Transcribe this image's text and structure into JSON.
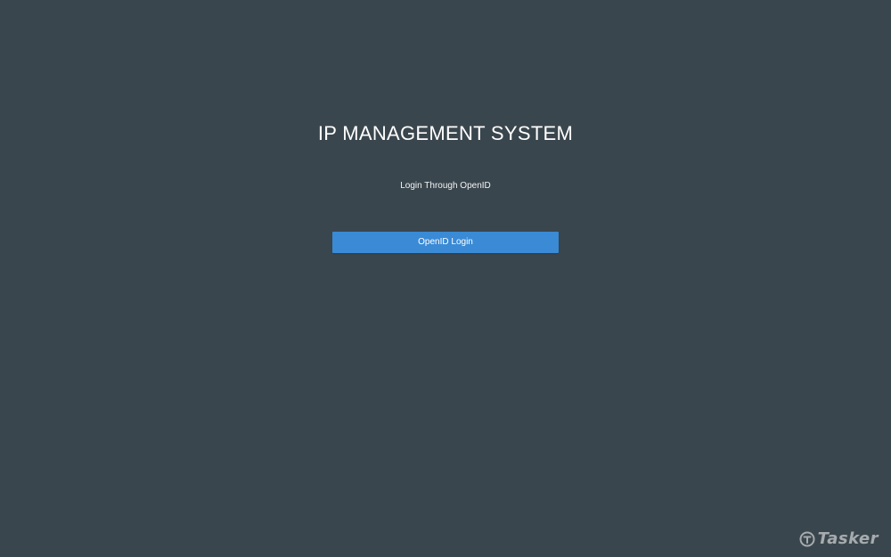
{
  "page": {
    "title": "IP MANAGEMENT SYSTEM",
    "subtitle": "Login Through OpenID"
  },
  "login": {
    "button_label": "OpenID Login"
  },
  "watermark": {
    "text": "Tasker",
    "icon": "tasker-logo-icon"
  },
  "colors": {
    "background": "#3a464d",
    "button": "#3a8ad6",
    "text": "#ffffff"
  }
}
